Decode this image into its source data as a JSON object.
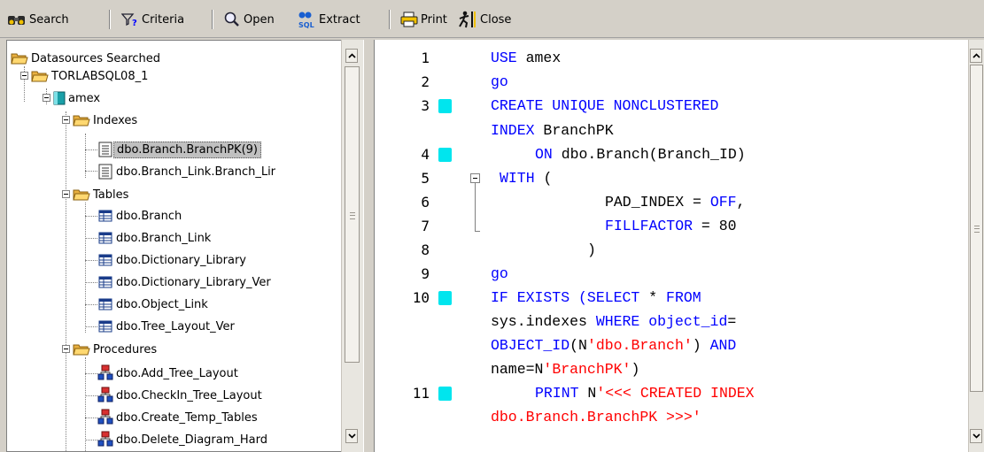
{
  "toolbar": {
    "search": "Search",
    "criteria": "Criteria",
    "open": "Open",
    "extract": "Extract",
    "print": "Print",
    "close": "Close"
  },
  "tree": {
    "root": "Datasources Searched",
    "server": "TORLABSQL08_1",
    "database": "amex",
    "indexes_folder": "Indexes",
    "indexes": [
      "dbo.Branch.BranchPK(9)",
      "dbo.Branch_Link.Branch_Lir"
    ],
    "tables_folder": "Tables",
    "tables": [
      "dbo.Branch",
      "dbo.Branch_Link",
      "dbo.Dictionary_Library",
      "dbo.Dictionary_Library_Ver",
      "dbo.Object_Link",
      "dbo.Tree_Layout_Ver"
    ],
    "procedures_folder": "Procedures",
    "procedures": [
      "dbo.Add_Tree_Layout",
      "dbo.CheckIn_Tree_Layout",
      "dbo.Create_Temp_Tables",
      "dbo.Delete_Diagram_Hard"
    ]
  },
  "editor": {
    "line_numbers": [
      "1",
      "2",
      "3",
      "4",
      "5",
      "6",
      "7",
      "8",
      "9",
      "10",
      "11"
    ],
    "code": {
      "l1_kw": "USE",
      "l1_id": " amex",
      "l2_kw": "go",
      "l3a_kw": "CREATE UNIQUE NONCLUSTERED",
      "l3b_kw": "INDEX",
      "l3b_id": " BranchPK",
      "l4_kw": "ON",
      "l4_id": " dbo.Branch(Branch_ID)",
      "l5_kw": "WITH",
      "l5_id": " (",
      "l6_id": "PAD_INDEX = ",
      "l6_kw": "OFF",
      "l6_tail": ",",
      "l7_kw": "FILLFACTOR",
      "l7_id": " = 80",
      "l8_id": ")",
      "l9_kw": "go",
      "l10a_kw": "IF EXISTS (SELECT",
      "l10a_id": " * ",
      "l10a_kw2": "FROM",
      "l10b_id": "sys.indexes ",
      "l10b_kw": "WHERE object_id",
      "l10b_id2": "=",
      "l10c_kw": "OBJECT_ID",
      "l10c_id": "(N",
      "l10c_str": "'dbo.Branch'",
      "l10c_id2": ") ",
      "l10c_kw2": "AND",
      "l10d_id": "name=N",
      "l10d_str": "'BranchPK'",
      "l10d_id2": ")",
      "l11a_kw": "PRINT",
      "l11a_id": " N",
      "l11a_str": "'<<< CREATED INDEX",
      "l11b_str": "dbo.Branch.BranchPK >>>'"
    }
  },
  "colors": {
    "keyword": "#0000ff",
    "string": "#ff0000",
    "breakpoint": "#00e5ee",
    "selection": "#c0c0c0"
  }
}
